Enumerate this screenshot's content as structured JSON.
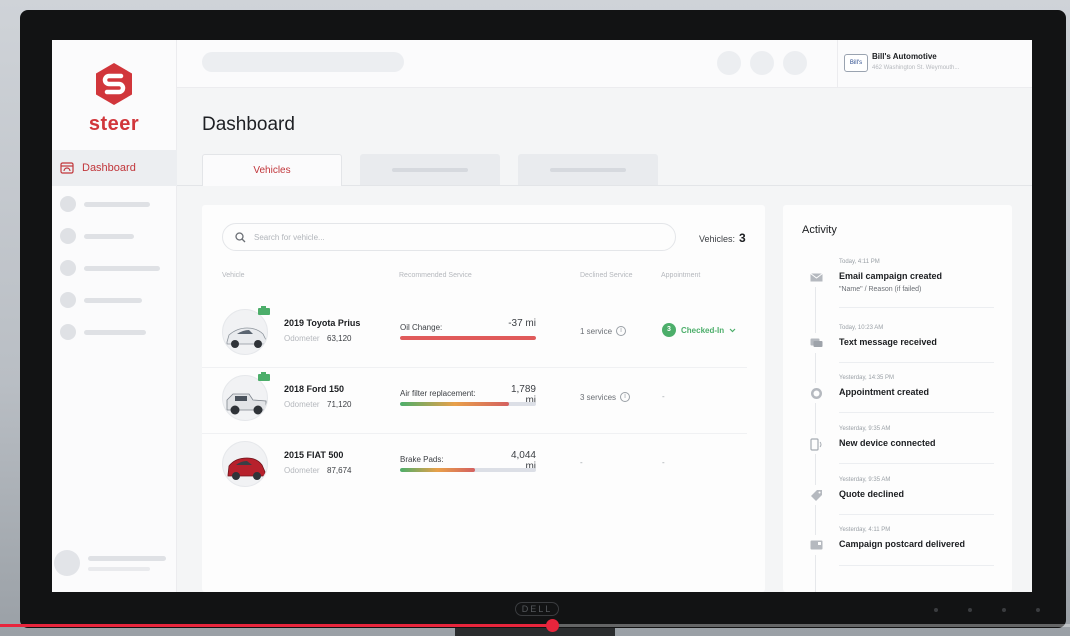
{
  "brand": {
    "name": "steer",
    "color": "#d1363b"
  },
  "sidebar": {
    "active_item": "Dashboard"
  },
  "shop": {
    "name": "Bill's Automotive",
    "address": "462 Washington St. Weymouth...",
    "logo_text": "Bill's"
  },
  "page": {
    "title": "Dashboard"
  },
  "tabs": {
    "active": "Vehicles"
  },
  "vehicles_panel": {
    "search_placeholder": "Search for vehicle...",
    "count_label": "Vehicles:",
    "count": "3",
    "columns": [
      "Vehicle",
      "Recommended Service",
      "Declined Service",
      "Appointment"
    ],
    "odometer_label": "Odometer",
    "rows": [
      {
        "name": "2019 Toyota Prius",
        "odometer": "63,120",
        "service": "Oil Change:",
        "service_value": "-37 mi",
        "progress": 1.0,
        "bar_color": "#e05a5a",
        "declined": "1 service",
        "appointment_num": "3",
        "appointment": "Checked-In",
        "engine_badge": true
      },
      {
        "name": "2018 Ford 150",
        "odometer": "71,120",
        "service": "Air filter replacement:",
        "service_value": "1,789 mi",
        "progress": 0.8,
        "bar_color": "#cc6a4a",
        "declined": "3 services",
        "appointment": "-",
        "engine_badge": true
      },
      {
        "name": "2015 FIAT 500",
        "odometer": "87,674",
        "service": "Brake Pads:",
        "service_value": "4,044 mi",
        "progress": 0.55,
        "bar_color": "#d46060",
        "declined": "-",
        "appointment": "-",
        "engine_badge": false
      }
    ]
  },
  "activity": {
    "title": "Activity",
    "items": [
      {
        "time": "Today, 4:11 PM",
        "text": "Email campaign created",
        "sub": "\"Name\" / Reason (if failed)",
        "icon": "envelope-icon"
      },
      {
        "time": "Today, 10:23 AM",
        "text": "Text message received",
        "sub": "",
        "icon": "chat-icon"
      },
      {
        "time": "Yesterday, 14:35 PM",
        "text": "Appointment created",
        "sub": "",
        "icon": "clock-icon"
      },
      {
        "time": "Yesterday, 9:35 AM",
        "text": "New device connected",
        "sub": "",
        "icon": "device-icon"
      },
      {
        "time": "Yesterday, 9:35 AM",
        "text": "Quote declined",
        "sub": "",
        "icon": "tag-icon"
      },
      {
        "time": "Yesterday, 4:11 PM",
        "text": "Campaign postcard delivered",
        "sub": "",
        "icon": "postcard-icon"
      }
    ]
  },
  "monitor": {
    "brand_text": "DELL"
  },
  "video": {
    "progress": 0.516
  }
}
